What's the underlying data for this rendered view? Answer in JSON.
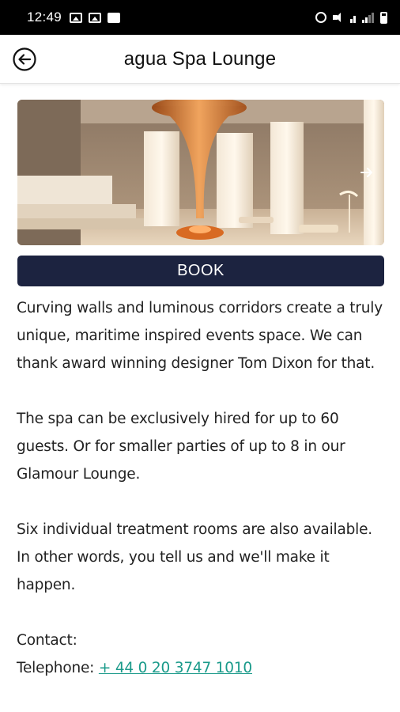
{
  "status_bar": {
    "time": "12:49",
    "left_icons": [
      "image-icon",
      "gallery-icon",
      "message-icon"
    ],
    "right_icons": [
      "alarm-icon",
      "mute-icon",
      "data-4g-icon",
      "signal-icon",
      "battery-icon"
    ]
  },
  "app_bar": {
    "title": "agua Spa Lounge",
    "back_icon": "back-arrow-icon"
  },
  "hero": {
    "next_icon": "chevron-right-icon"
  },
  "book_label": "BOOK",
  "content": {
    "paragraph_1": "Curving walls and luminous corridors create a truly unique, maritime inspired events space. We can thank award winning designer Tom Dixon for that.",
    "paragraph_2": "The spa can be exclusively hired for up to 60 guests. Or for smaller parties of up to 8 in our Glamour Lounge.",
    "paragraph_3": "Six individual treatment rooms are also available. In other words, you tell us and we'll make it happen.",
    "contact_label": "Contact:",
    "telephone_label": "Telephone:",
    "telephone_value": "+ 44 0 20 3747 1010"
  },
  "colors": {
    "book_button": "#1c2340",
    "link": "#1a9a8a",
    "status_bar": "#000000"
  }
}
